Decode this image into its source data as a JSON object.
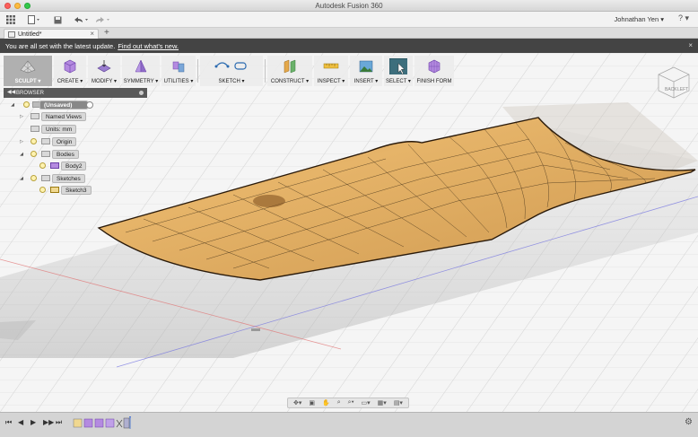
{
  "window": {
    "title": "Autodesk Fusion 360"
  },
  "app_toolbar": {
    "user": "Johnathan Yen ▾",
    "help": "?"
  },
  "tabs": [
    {
      "label": "Untitled*",
      "close": "×"
    }
  ],
  "notification": {
    "text": "You are all set with the latest update.",
    "link": "Find out what's new.",
    "close": "×"
  },
  "ribbon": {
    "groups": [
      {
        "label": "SCULPT ▾",
        "icon": "sculpt-grid-icon"
      },
      {
        "label": "CREATE ▾",
        "icon": "create-box-icon"
      },
      {
        "label": "MODIFY ▾",
        "icon": "modify-icon"
      },
      {
        "label": "SYMMETRY ▾",
        "icon": "symmetry-icon"
      },
      {
        "label": "UTILITIES ▾",
        "icon": "utilities-icon"
      },
      {
        "label": "SKETCH ▾",
        "icon": "sketch-icon"
      },
      {
        "label": "CONSTRUCT ▾",
        "icon": "construct-plane-icon"
      },
      {
        "label": "INSPECT ▾",
        "icon": "inspect-ruler-icon"
      },
      {
        "label": "INSERT ▾",
        "icon": "insert-image-icon"
      },
      {
        "label": "SELECT ▾",
        "icon": "select-cursor-icon"
      },
      {
        "label": "FINISH FORM",
        "icon": "finish-form-icon"
      }
    ]
  },
  "browser": {
    "title": "BROWSER",
    "root": "(Unsaved)",
    "nodes": [
      "Named Views",
      "Units: mm",
      "Origin",
      "Bodies",
      "Body2",
      "Sketches",
      "Sketch3"
    ]
  },
  "viewcube": {
    "front": "BACK",
    "side": "LEFT"
  },
  "colors": {
    "surface": "#d9a85a",
    "notify_bar": "#444444",
    "select_active": "#3d6e7c"
  }
}
